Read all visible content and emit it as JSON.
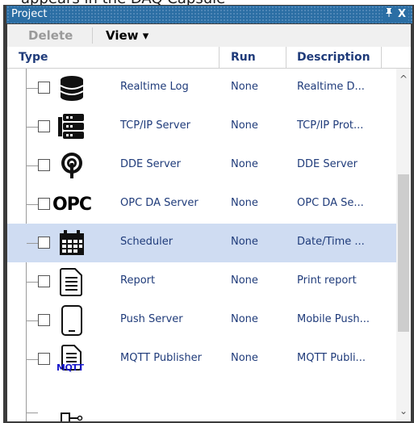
{
  "background_caption": "appears in the DAQ Capsule",
  "window": {
    "title": "Project",
    "pin_glyph": "p",
    "close_glyph": "X"
  },
  "toolbar": {
    "delete_label": "Delete",
    "view_label": "View ▾"
  },
  "columns": {
    "type": "Type",
    "run": "Run",
    "description": "Description"
  },
  "rows": [
    {
      "icon": "database-icon",
      "name": "Realtime Log",
      "run": "None",
      "description": "Realtime D...",
      "selected": false
    },
    {
      "icon": "server-icon",
      "name": "TCP/IP Server",
      "run": "None",
      "description": "TCP/IP Prot...",
      "selected": false
    },
    {
      "icon": "dde-antenna-icon",
      "name": "DDE Server",
      "run": "None",
      "description": "DDE Server",
      "selected": false
    },
    {
      "icon": "opc-logo-icon",
      "name": "OPC DA Server",
      "run": "None",
      "description": "OPC DA Se...",
      "selected": false
    },
    {
      "icon": "calendar-icon",
      "name": "Scheduler",
      "run": "None",
      "description": "Date/Time ...",
      "selected": true
    },
    {
      "icon": "report-document-icon",
      "name": "Report",
      "run": "None",
      "description": "Print report",
      "selected": false
    },
    {
      "icon": "mobile-phone-icon",
      "name": "Push Server",
      "run": "None",
      "description": "Mobile Push...",
      "selected": false
    },
    {
      "icon": "mqtt-document-icon",
      "name": "MQTT Publisher",
      "run": "None",
      "description": "MQTT Publi...",
      "selected": false
    }
  ],
  "mqtt_icon_text": "MQTT",
  "opc_logo_text": "OPC",
  "colors": {
    "title_bar": "#2b6ea4",
    "selection": "#cfdcf2",
    "link_text": "#1f3b7a"
  }
}
